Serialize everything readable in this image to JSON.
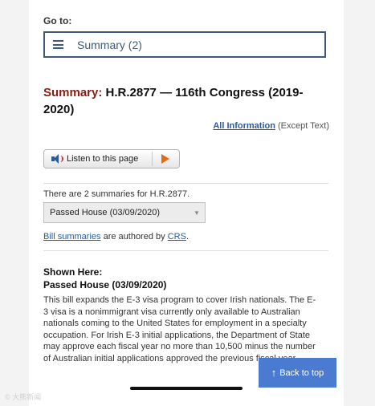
{
  "goto": {
    "label": "Go to:",
    "selected": "Summary (2)",
    "icon": "hamburger-menu-icon"
  },
  "header": {
    "summary_word": "Summary:",
    "bill_title": "H.R.2877 — 116th Congress (2019-2020)"
  },
  "all_information": {
    "link_label": "All Information",
    "suffix": "(Except Text)"
  },
  "listen": {
    "label": "Listen to this page",
    "speaker_icon": "speaker-icon",
    "play_icon": "play-icon"
  },
  "summaries": {
    "count_text": "There are 2 summaries for H.R.2877.",
    "selected_version": "Passed House (03/09/2020)",
    "authored_link1": "Bill summaries",
    "authored_mid": "are authored by",
    "authored_link2": "CRS",
    "authored_end": "."
  },
  "shown": {
    "heading": "Shown Here:",
    "version": "Passed House (03/09/2020)",
    "body_lines": [
      "This bill expands the E-3 visa program to cover Irish nationals. The E-",
      "3 visa is a nonimmigrant visa currently only available to Australian",
      "nationals coming to the United States for employment in a specialty",
      "occupation. For Irish E-3 initial applications, the Department of State",
      "may approve each fiscal year no more than 10,500 minus the number",
      "of Australian initial applications approved the previous fiscal year."
    ]
  },
  "back_to_top": {
    "label": "Back to top",
    "arrow": "🡑"
  },
  "watermark": "© 大熊新闻",
  "colors": {
    "summary_red": "#8a1c12",
    "link_blue": "#2a5a9f",
    "goto_border": "#3d5b78",
    "back_to_top_bg": "#4a7bd0",
    "play_orange": "#e56a18"
  }
}
